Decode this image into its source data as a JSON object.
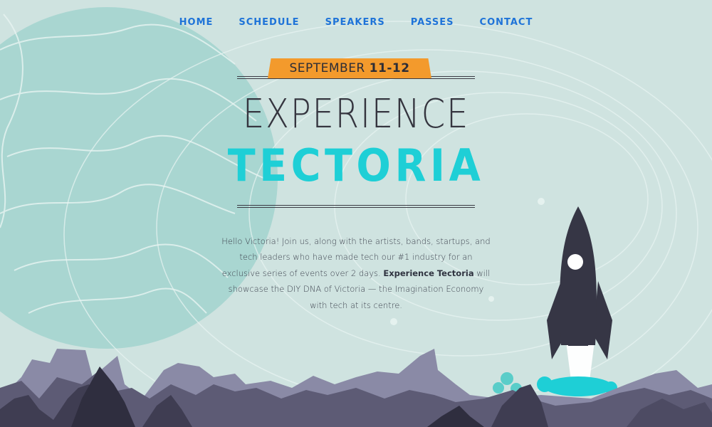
{
  "nav": {
    "items": [
      {
        "label": "HOME"
      },
      {
        "label": "SCHEDULE"
      },
      {
        "label": "SPEAKERS"
      },
      {
        "label": "PASSES"
      },
      {
        "label": "CONTACT"
      }
    ]
  },
  "hero": {
    "date_month": "SEPTEMBER",
    "date_days": "11-12",
    "title_line1": "EXPERIENCE",
    "title_line2": "TECTORIA",
    "intro_part1": "Hello Victoria! Join us, along with the artists, bands, startups, and tech leaders who have made tech our #1 industry for an exclusive series of events over 2 days. ",
    "intro_bold": "Experience Tectoria",
    "intro_part2": " will showcase the DIY DNA of Victoria — the Imagination Economy with tech at its centre."
  },
  "colors": {
    "background": "#cfe3e0",
    "planet": "#a9d6d1",
    "nav_link": "#1e73d8",
    "accent_cyan": "#1ecfd6",
    "banner_orange": "#f39a2c",
    "rocket": "#363645",
    "mountains_light": "#8a8aa6",
    "mountains_dark": "#4d4b63"
  },
  "icons": {
    "rocket": "rocket-icon",
    "planet": "planet-illustration",
    "mountains": "mountain-range-illustration"
  }
}
